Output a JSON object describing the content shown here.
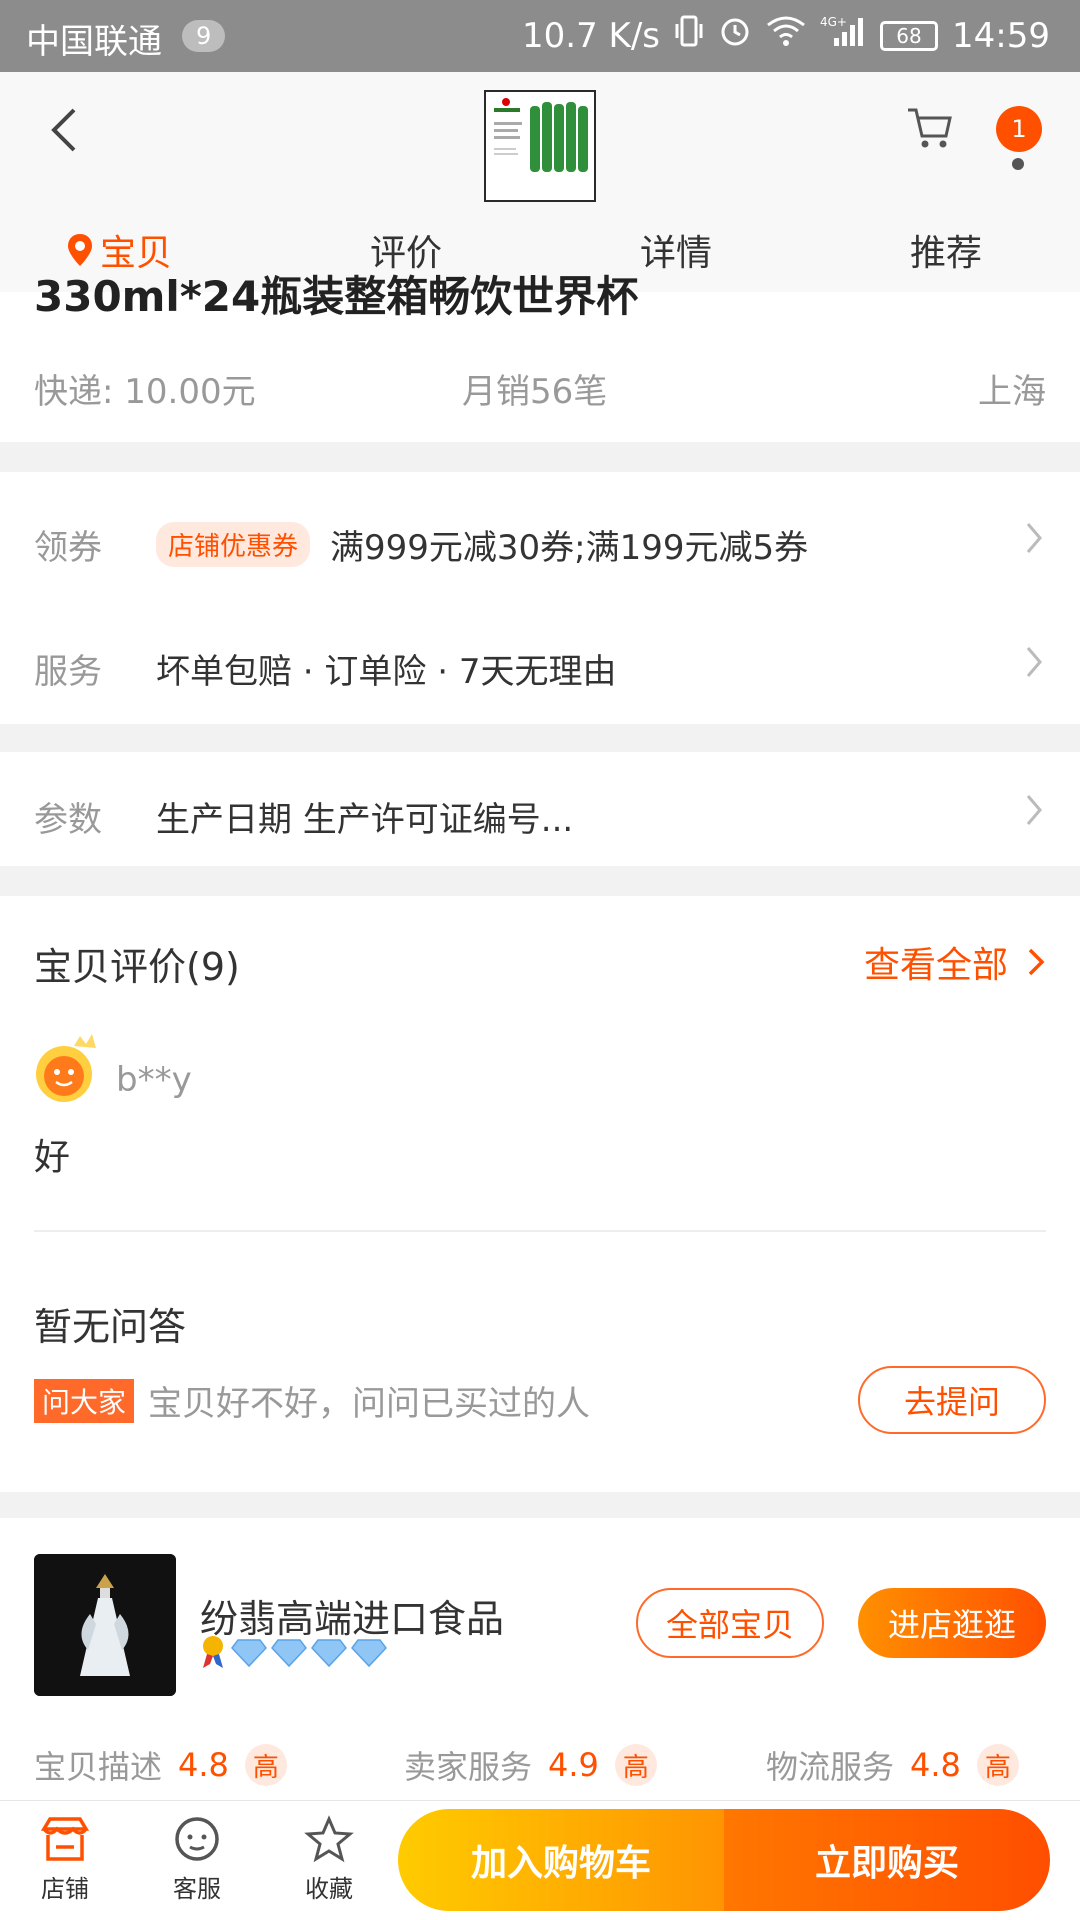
{
  "status_bar": {
    "carrier": "中国联通",
    "notification_count": "9",
    "network_speed": "10.7 K/s",
    "network_type": "4G+",
    "battery": "68",
    "time": "14:59"
  },
  "header": {
    "cart_badge": "1",
    "tabs": [
      {
        "label": "宝贝",
        "active": true
      },
      {
        "label": "评价",
        "active": false
      },
      {
        "label": "详情",
        "active": false
      },
      {
        "label": "推荐",
        "active": false
      }
    ]
  },
  "product": {
    "title_partial": "330ml*24瓶装整箱畅饮世界杯",
    "shipping": "快递: 10.00元",
    "monthly_sales": "月销56笔",
    "location": "上海"
  },
  "coupon": {
    "label": "领券",
    "tag": "店铺优惠券",
    "text": "满999元减30券;满199元减5券"
  },
  "service": {
    "label": "服务",
    "text": "坏单包赔 · 订单险 · 7天无理由"
  },
  "params": {
    "label": "参数",
    "text": "生产日期 生产许可证编号..."
  },
  "reviews": {
    "title": "宝贝评价(9)",
    "view_all": "查看全部",
    "items": [
      {
        "user": "b**y",
        "content": "好"
      }
    ]
  },
  "qa": {
    "title": "暂无问答",
    "tag": "问大家",
    "prompt": "宝贝好不好，问问已买过的人",
    "ask_button": "去提问"
  },
  "shop": {
    "name": "纷翡高端进口食品",
    "all_items_button": "全部宝贝",
    "visit_button": "进店逛逛",
    "diamonds": 4,
    "ratings": [
      {
        "label": "宝贝描述",
        "score": "4.8",
        "level": "高"
      },
      {
        "label": "卖家服务",
        "score": "4.9",
        "level": "高"
      },
      {
        "label": "物流服务",
        "score": "4.8",
        "level": "高"
      }
    ]
  },
  "bottom_bar": {
    "shop": "店铺",
    "service": "客服",
    "favorite": "收藏",
    "add_to_cart": "加入购物车",
    "buy_now": "立即购买"
  },
  "colors": {
    "accent": "#ff5000",
    "cart_gradient_start": "#ffcb00",
    "buy_gradient_end": "#ff4e00"
  }
}
